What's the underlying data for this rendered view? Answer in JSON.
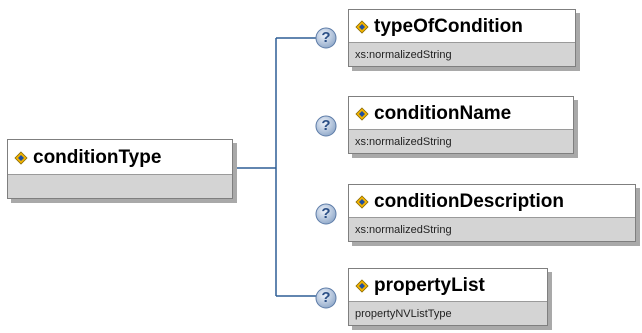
{
  "root": {
    "name": "conditionType"
  },
  "children": [
    {
      "name": "typeOfCondition",
      "type": "xs:normalizedString"
    },
    {
      "name": "conditionName",
      "type": "xs:normalizedString"
    },
    {
      "name": "conditionDescription",
      "type": "xs:normalizedString"
    },
    {
      "name": "propertyList",
      "type": "propertyNVListType"
    }
  ],
  "help_glyph": "?",
  "colors": {
    "line": "#2e5f95",
    "type_band": "#d4d4d4",
    "border": "#7f7f7f",
    "shadow": "#a9a9a9"
  }
}
